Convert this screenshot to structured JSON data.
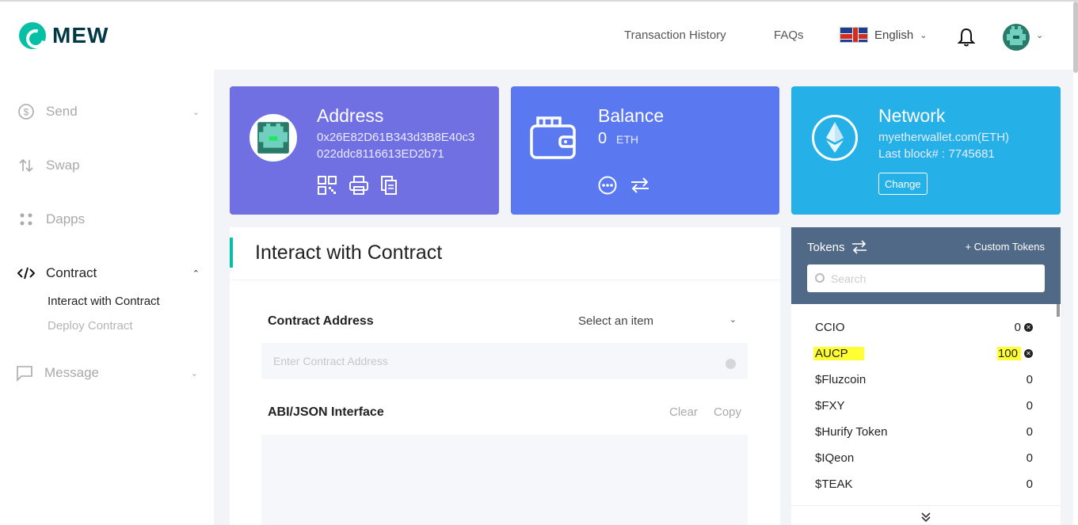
{
  "brand": {
    "name": "MEW"
  },
  "nav": {
    "transaction_history": "Transaction History",
    "faqs": "FAQs",
    "language": "English"
  },
  "sidebar": {
    "items": [
      {
        "label": "Send",
        "icon": "send-dollar-icon",
        "expanded": false
      },
      {
        "label": "Swap",
        "icon": "swap-icon",
        "expanded": false
      },
      {
        "label": "Dapps",
        "icon": "dapps-grid-icon",
        "expanded": false
      },
      {
        "label": "Contract",
        "icon": "code-icon",
        "expanded": true
      },
      {
        "label": "Message",
        "icon": "message-icon",
        "expanded": false
      }
    ],
    "contract_sub": [
      "Interact with Contract",
      "Deploy Contract"
    ]
  },
  "cards": {
    "address": {
      "title": "Address",
      "line1": "0x26E82D61B343d3B8E40c3",
      "line2": "022ddc8116613ED2b71",
      "color": "#7070e3"
    },
    "balance": {
      "title": "Balance",
      "amount": "0",
      "unit": "ETH",
      "color": "#5a78f0"
    },
    "network": {
      "title": "Network",
      "name": "myetherwallet.com(ETH)",
      "last_block": "Last block# : 7745681",
      "change_label": "Change",
      "color": "#25b0e8"
    }
  },
  "contract": {
    "title": "Interact with Contract",
    "address_label": "Contract Address",
    "select_placeholder": "Select an item",
    "address_placeholder": "Enter Contract Address",
    "abi_label": "ABI/JSON Interface",
    "clear_label": "Clear",
    "copy_label": "Copy"
  },
  "tokens": {
    "title": "Tokens",
    "custom_label": "+ Custom Tokens",
    "search_placeholder": "Search",
    "list": [
      {
        "name": "CCIO",
        "value": "0",
        "removable": true,
        "highlighted": false
      },
      {
        "name": "AUCP",
        "value": "100",
        "removable": true,
        "highlighted": true
      },
      {
        "name": "$Fluzcoin",
        "value": "0",
        "removable": false,
        "highlighted": false
      },
      {
        "name": "$FXY",
        "value": "0",
        "removable": false,
        "highlighted": false
      },
      {
        "name": "$Hurify Token",
        "value": "0",
        "removable": false,
        "highlighted": false
      },
      {
        "name": "$IQeon",
        "value": "0",
        "removable": false,
        "highlighted": false
      },
      {
        "name": "$TEAK",
        "value": "0",
        "removable": false,
        "highlighted": false
      }
    ],
    "expand_icon": "double-chevron-down-icon"
  },
  "colors": {
    "accent": "#05c0a5",
    "tokens_header": "#506987",
    "highlight": "#ffff33"
  }
}
